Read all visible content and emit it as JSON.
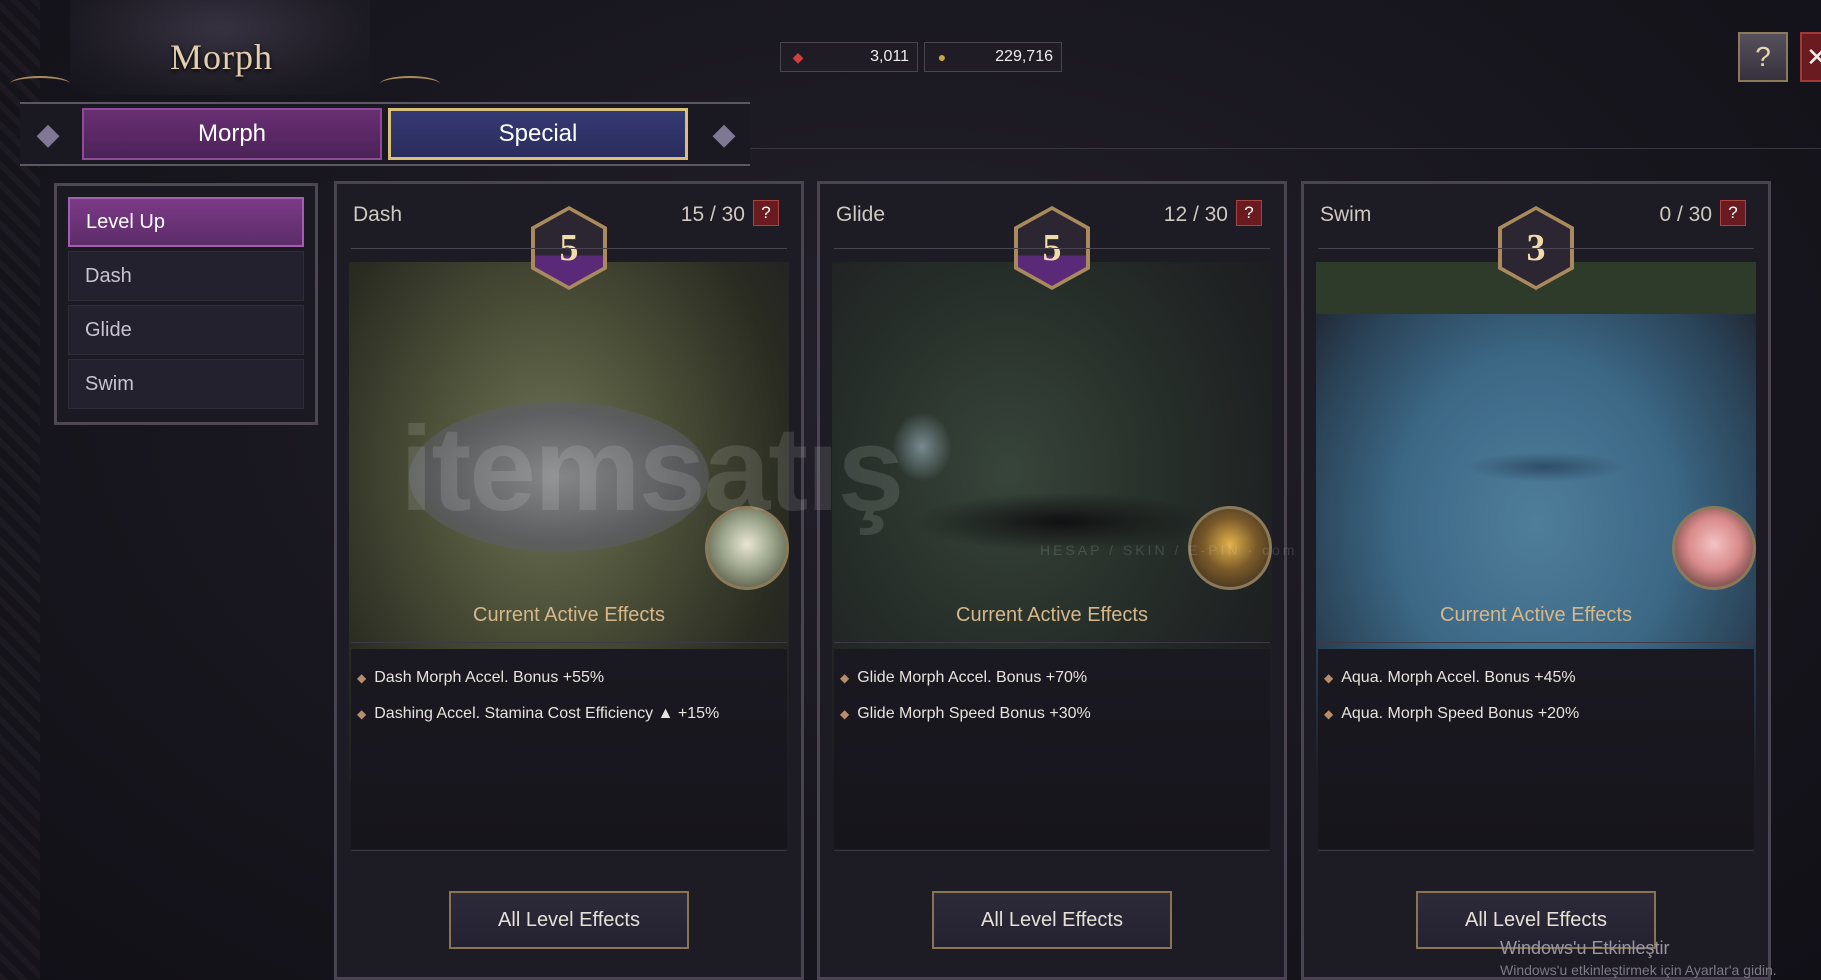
{
  "header": {
    "title": "Morph",
    "currencies": [
      {
        "icon": "red-gem-icon",
        "value": "3,011"
      },
      {
        "icon": "gold-coin-icon",
        "value": "229,716"
      }
    ]
  },
  "tabs": [
    {
      "label": "Morph"
    },
    {
      "label": "Special"
    }
  ],
  "sidebar": {
    "items": [
      {
        "label": "Level Up"
      },
      {
        "label": "Dash"
      },
      {
        "label": "Glide"
      },
      {
        "label": "Swim"
      }
    ]
  },
  "cards": [
    {
      "name": "Dash",
      "level": "5",
      "count": "15  /  30",
      "effects_title": "Current Active Effects",
      "effects": [
        "Dash Morph Accel. Bonus +55%",
        "Dashing Accel. Stamina Cost Efficiency ▲ +15%"
      ],
      "button": "All Level Effects"
    },
    {
      "name": "Glide",
      "level": "5",
      "count": "12  /  30",
      "effects_title": "Current Active Effects",
      "effects": [
        "Glide Morph Accel. Bonus +70%",
        "Glide Morph Speed Bonus  +30%"
      ],
      "button": "All Level Effects"
    },
    {
      "name": "Swim",
      "level": "3",
      "count": "0  /  30",
      "effects_title": "Current Active Effects",
      "effects": [
        "Aqua. Morph Accel. Bonus +45%",
        "Aqua. Morph Speed Bonus +20%"
      ],
      "button": "All Level Effects"
    }
  ],
  "watermark": {
    "main": "itemsatış",
    "sub": "HESAP / SKIN / E-PIN · com"
  },
  "os_notice": {
    "title": "Windows'u Etkinleştir",
    "subtitle": "Windows'u etkinleştirmek için Ayarlar'a gidin."
  },
  "colors": {
    "accent_purple": "#6a2f73",
    "accent_blue": "#363a74",
    "gold": "#d9c07a"
  }
}
